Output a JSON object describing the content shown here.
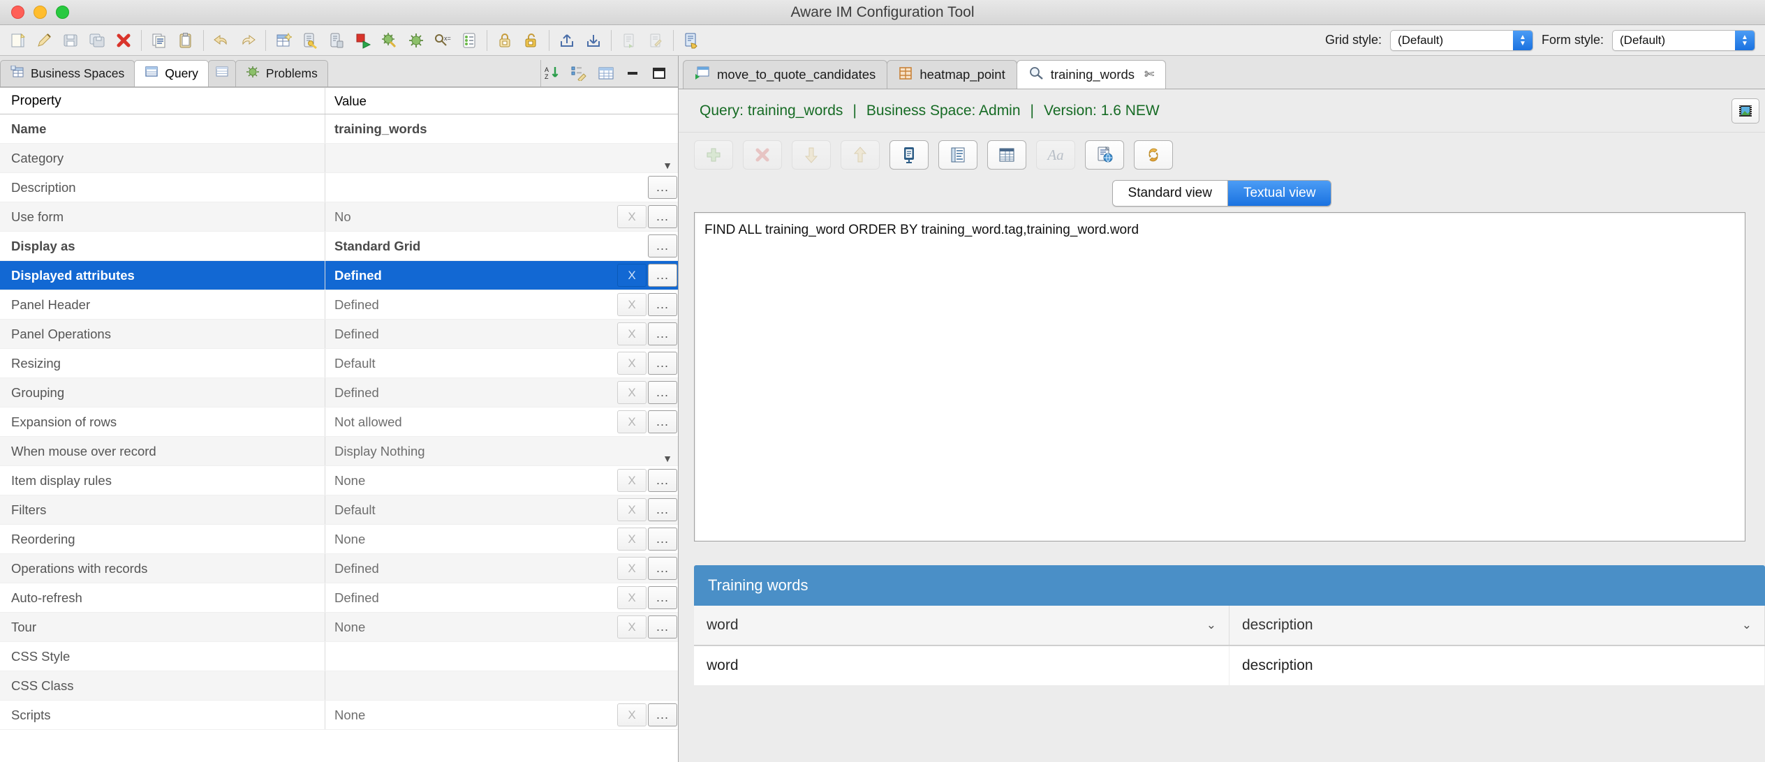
{
  "window": {
    "title": "Aware IM Configuration Tool"
  },
  "toolbar": {
    "groups": [
      {
        "items": [
          {
            "name": "new-icon",
            "label": "New"
          },
          {
            "name": "edit-pencil-icon",
            "label": "Edit"
          },
          {
            "name": "save-icon",
            "label": "Save"
          },
          {
            "name": "save-all-icon",
            "label": "Save All"
          },
          {
            "name": "delete-icon",
            "label": "Delete"
          }
        ]
      },
      {
        "items": [
          {
            "name": "copy-icon",
            "label": "Copy"
          },
          {
            "name": "paste-icon",
            "label": "Paste"
          }
        ]
      },
      {
        "items": [
          {
            "name": "undo-icon",
            "label": "Undo"
          },
          {
            "name": "redo-icon",
            "label": "Redo"
          }
        ]
      },
      {
        "items": [
          {
            "name": "new-business-space-icon",
            "label": "New Business Space"
          },
          {
            "name": "key-document-icon",
            "label": "Security"
          },
          {
            "name": "server-delete-icon",
            "label": "Remove Server"
          },
          {
            "name": "stop-run-icon",
            "label": "Stop and Run"
          },
          {
            "name": "debug-star-icon",
            "label": "Debug"
          },
          {
            "name": "debug-bug-icon",
            "label": "Debug Bug"
          },
          {
            "name": "query-tool-icon",
            "label": "Query Tool"
          },
          {
            "name": "checklist-icon",
            "label": "Checklist"
          }
        ]
      },
      {
        "items": [
          {
            "name": "lock-closed-icon",
            "label": "Lock"
          },
          {
            "name": "lock-open-icon",
            "label": "Unlock"
          },
          {
            "name": "export-icon",
            "label": "Export"
          },
          {
            "name": "import-icon",
            "label": "Import"
          }
        ]
      },
      {
        "items": [
          {
            "name": "doc-green-icon",
            "label": "Document"
          },
          {
            "name": "doc-edit-icon",
            "label": "Edit Document"
          }
        ]
      },
      {
        "items": [
          {
            "name": "doc-hand-icon",
            "label": "Apply"
          }
        ]
      }
    ],
    "grid_style_label": "Grid style:",
    "grid_style_value": "(Default)",
    "form_style_label": "Form style:",
    "form_style_value": "(Default)"
  },
  "left": {
    "tabs": [
      {
        "label": "Business Spaces",
        "icon": "business-spaces-icon",
        "active": false,
        "iconOnly": false
      },
      {
        "label": "Query",
        "icon": "query-table-icon",
        "active": true,
        "iconOnly": false
      },
      {
        "label": "",
        "icon": "table-icon",
        "active": false,
        "iconOnly": true
      },
      {
        "label": "Problems",
        "icon": "problems-bug-icon",
        "active": false,
        "iconOnly": false
      }
    ],
    "tab_right_icons": [
      {
        "name": "sort-az-icon"
      },
      {
        "name": "hierarchy-edit-icon"
      },
      {
        "name": "grid-view-icon"
      },
      {
        "name": "minimize-icon"
      },
      {
        "name": "maximize-icon"
      }
    ],
    "table": {
      "headers": {
        "property": "Property",
        "value": "Value"
      },
      "rows": [
        {
          "property": "Name",
          "value": "training_words",
          "bold": true,
          "buttons": "none",
          "selected": false
        },
        {
          "property": "Category",
          "value": "",
          "bold": false,
          "buttons": "caret",
          "selected": false
        },
        {
          "property": "Description",
          "value": "",
          "bold": false,
          "buttons": "dots",
          "selected": false
        },
        {
          "property": "Use form",
          "value": "No",
          "bold": false,
          "buttons": "xdots",
          "selected": false
        },
        {
          "property": "Display as",
          "value": "Standard Grid",
          "bold": true,
          "buttons": "dots",
          "selected": false
        },
        {
          "property": "Displayed attributes",
          "value": "Defined",
          "bold": true,
          "buttons": "xdots",
          "selected": true
        },
        {
          "property": "Panel Header",
          "value": "Defined",
          "bold": false,
          "buttons": "xdots",
          "selected": false
        },
        {
          "property": "Panel Operations",
          "value": "Defined",
          "bold": false,
          "buttons": "xdots",
          "selected": false
        },
        {
          "property": "Resizing",
          "value": "Default",
          "bold": false,
          "buttons": "xdots",
          "selected": false
        },
        {
          "property": "Grouping",
          "value": "Defined",
          "bold": false,
          "buttons": "xdots",
          "selected": false
        },
        {
          "property": "Expansion of rows",
          "value": "Not allowed",
          "bold": false,
          "buttons": "xdots",
          "selected": false
        },
        {
          "property": "When mouse over record",
          "value": "Display Nothing",
          "bold": false,
          "buttons": "caret",
          "selected": false
        },
        {
          "property": "Item display rules",
          "value": "None",
          "bold": false,
          "buttons": "xdots",
          "selected": false
        },
        {
          "property": "Filters",
          "value": "Default",
          "bold": false,
          "buttons": "xdots",
          "selected": false
        },
        {
          "property": "Reordering",
          "value": "None",
          "bold": false,
          "buttons": "xdots",
          "selected": false
        },
        {
          "property": "Operations with records",
          "value": "Defined",
          "bold": false,
          "buttons": "xdots",
          "selected": false
        },
        {
          "property": "Auto-refresh",
          "value": "Defined",
          "bold": false,
          "buttons": "xdots",
          "selected": false
        },
        {
          "property": "Tour",
          "value": "None",
          "bold": false,
          "buttons": "xdots",
          "selected": false
        },
        {
          "property": "CSS Style",
          "value": "",
          "bold": false,
          "buttons": "none",
          "selected": false
        },
        {
          "property": "CSS Class",
          "value": "",
          "bold": false,
          "buttons": "none",
          "selected": false
        },
        {
          "property": "Scripts",
          "value": "None",
          "bold": false,
          "buttons": "xdots",
          "selected": false
        }
      ],
      "button_labels": {
        "clear": "X",
        "more": "..."
      }
    }
  },
  "right": {
    "tabs": [
      {
        "label": "move_to_quote_candidates",
        "icon": "process-window-icon",
        "active": false
      },
      {
        "label": "heatmap_point",
        "icon": "grid-orange-icon",
        "active": false
      },
      {
        "label": "training_words",
        "icon": "magnifier-icon",
        "active": true,
        "close": "✄"
      }
    ],
    "query_header": {
      "query": "Query: training_words",
      "sep1": "|",
      "business_space": "Business Space: Admin",
      "sep2": "|",
      "version": "Version: 1.6 NEW",
      "right_icon": "film-preview-icon"
    },
    "query_toolbar": [
      {
        "name": "add-green-plus-icon",
        "enabled": false
      },
      {
        "name": "delete-red-x-icon",
        "enabled": false
      },
      {
        "name": "move-down-arrow-icon",
        "enabled": false
      },
      {
        "name": "move-up-arrow-icon",
        "enabled": false
      },
      {
        "name": "form-panel-icon",
        "enabled": true
      },
      {
        "name": "list-panel-icon",
        "enabled": true
      },
      {
        "name": "grid-panel-icon",
        "enabled": true
      },
      {
        "name": "text-Aa-icon",
        "enabled": false,
        "label": "Aa"
      },
      {
        "name": "document-globe-icon",
        "enabled": true
      },
      {
        "name": "link-chain-icon",
        "enabled": true
      }
    ],
    "view_toggle": {
      "standard_label": "Standard view",
      "textual_label": "Textual view",
      "selected": "Textual view"
    },
    "query_text": "FIND ALL training_word ORDER BY training_word.tag,training_word.word",
    "preview": {
      "title": "Training words",
      "columns": [
        {
          "label": "word",
          "chevron": "⌄"
        },
        {
          "label": "description",
          "chevron": "⌄"
        }
      ],
      "rows": [
        {
          "cells": [
            "word",
            "description"
          ]
        }
      ]
    }
  },
  "colors": {
    "selection_blue": "#1268d3",
    "toggle_blue": "#1a72e0",
    "preview_header_blue": "#4a8fc7",
    "query_green": "#166b24"
  }
}
